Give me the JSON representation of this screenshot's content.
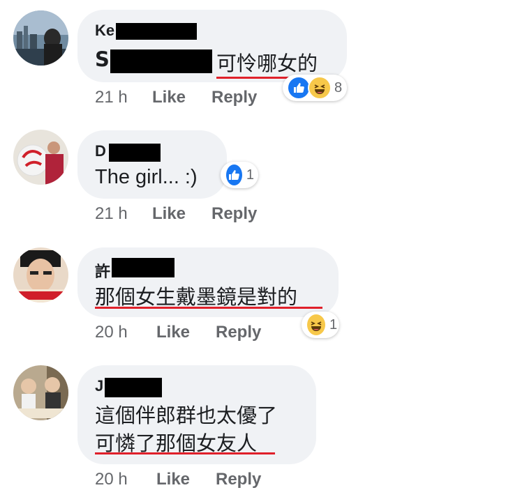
{
  "comments": [
    {
      "author_visible": "Ke",
      "lines": [
        "S",
        "可怜哪女的"
      ],
      "time": "21 h",
      "like_label": "Like",
      "reply_label": "Reply",
      "reactions": [
        "like-icon",
        "haha-icon"
      ],
      "reaction_count": "8"
    },
    {
      "author_visible": "D",
      "lines": [
        "The girl... :)"
      ],
      "time": "21 h",
      "like_label": "Like",
      "reply_label": "Reply",
      "reactions": [
        "like-icon"
      ],
      "reaction_count": "1"
    },
    {
      "author_visible": "許",
      "lines": [
        "那個女生戴墨鏡是對的"
      ],
      "time": "20 h",
      "like_label": "Like",
      "reply_label": "Reply",
      "reactions": [
        "haha-icon"
      ],
      "reaction_count": "1"
    },
    {
      "author_visible": "J",
      "lines": [
        "這個伴郎群也太優了",
        "可憐了那個女友人"
      ],
      "time": "20 h",
      "like_label": "Like",
      "reply_label": "Reply",
      "reactions": [],
      "reaction_count": ""
    }
  ],
  "colors": {
    "bubble": "#f0f2f5",
    "underline": "#e0202a",
    "like_blue": "#1877f2",
    "haha_yellow": "#f7c84a",
    "meta_gray": "#65676b"
  }
}
